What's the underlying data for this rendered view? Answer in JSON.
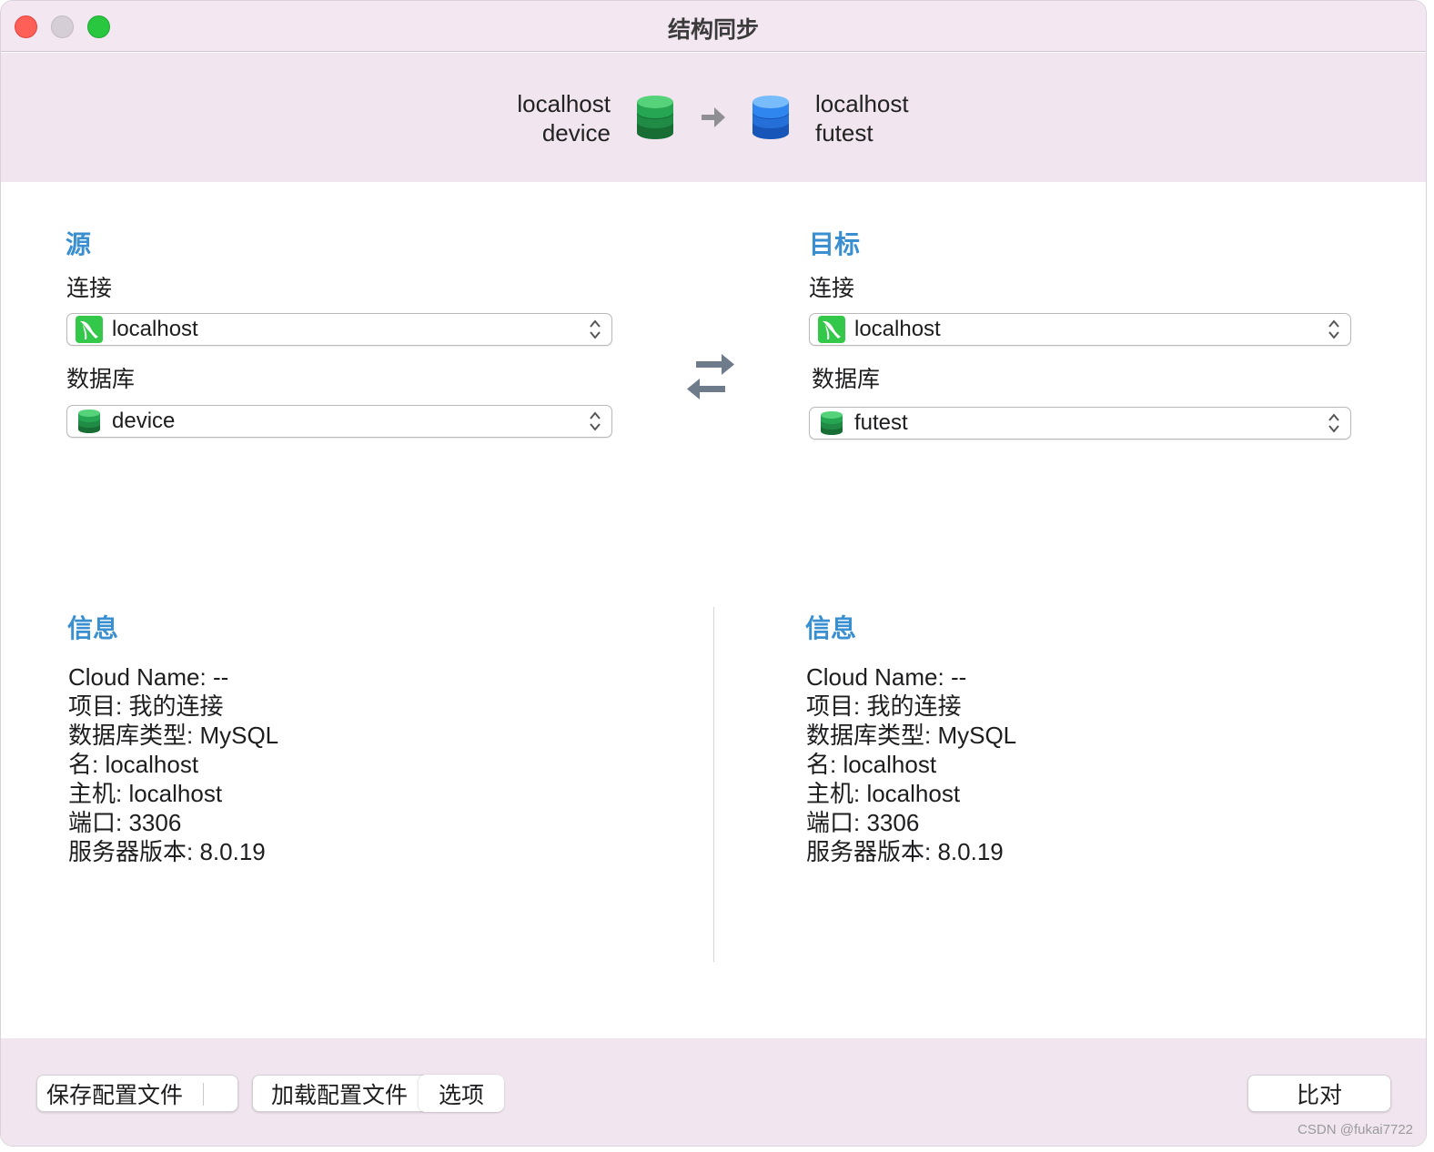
{
  "window": {
    "title": "结构同步"
  },
  "header": {
    "source": {
      "host": "localhost",
      "database": "device"
    },
    "target": {
      "host": "localhost",
      "database": "futest"
    },
    "arrow_icon": "arrow-right-icon"
  },
  "source": {
    "section_title": "源",
    "connection_label": "连接",
    "connection_value": "localhost",
    "database_label": "数据库",
    "database_value": "device"
  },
  "target": {
    "section_title": "目标",
    "connection_label": "连接",
    "connection_value": "localhost",
    "database_label": "数据库",
    "database_value": "futest"
  },
  "swap_icon": "swap-arrows-icon",
  "source_info": {
    "title": "信息",
    "lines": [
      "Cloud Name: --",
      "项目: 我的连接",
      "数据库类型: MySQL",
      "名: localhost",
      "主机: localhost",
      "端口: 3306",
      "服务器版本: 8.0.19"
    ]
  },
  "target_info": {
    "title": "信息",
    "lines": [
      "Cloud Name: --",
      "项目: 我的连接",
      "数据库类型: MySQL",
      "名: localhost",
      "主机: localhost",
      "端口: 3306",
      "服务器版本: 8.0.19"
    ]
  },
  "buttons": {
    "save_profile": "保存配置文件",
    "save_dropdown": "▾",
    "load_profile": "加载配置文件",
    "options": "选项",
    "compare": "比对"
  },
  "watermark": "CSDN @fukai7722",
  "colors": {
    "accent_blue": "#3a8fd0",
    "band_background": "#f1e6ef",
    "db_green": "#1f9a47",
    "db_blue": "#2f7fe0",
    "mysql_green": "#34c84a"
  }
}
